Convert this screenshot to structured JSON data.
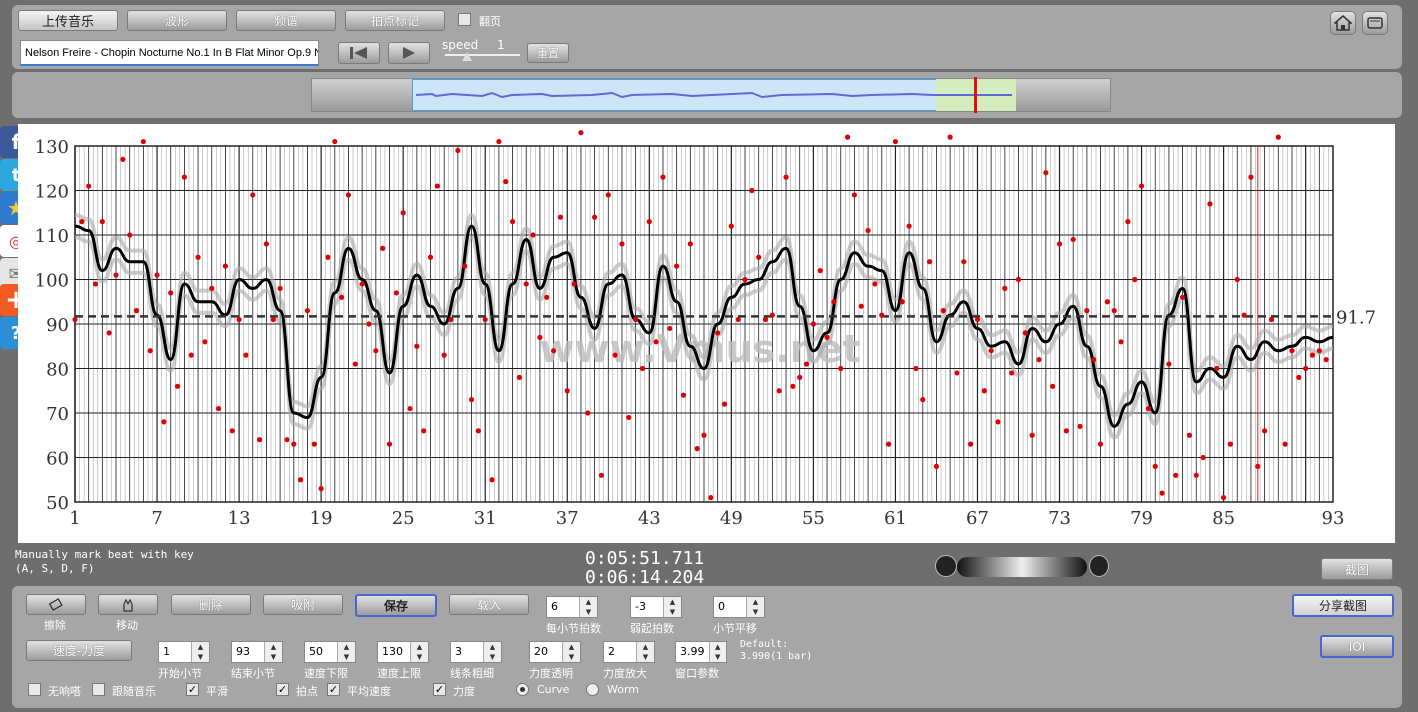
{
  "top": {
    "upload_label": "上传音乐",
    "waveform_label": "波形",
    "spectrum_label": "频谱",
    "beat_label": "拍点标记",
    "flip_label": "翻页",
    "track_title": "Nelson Freire - Chopin Nocturne No.1 In B Flat Minor Op.9 N",
    "speed_label": "speed",
    "speed_value": "1",
    "reset_label": "重置"
  },
  "info": {
    "hint_line1": "Manually mark beat with key",
    "hint_line2": "(A, S, D, F)",
    "time_current": "0:05:51.711",
    "time_total": "0:06:14.204",
    "screenshot_label": "截图",
    "share_label": "分享截图",
    "ioi_label": "IOI"
  },
  "tools": {
    "erase_label": "擦除",
    "move_label": "移动",
    "delete_label": "删除",
    "snap_label": "吸附",
    "save_label": "保存",
    "load_label": "载入",
    "tempo_dynamics_label": "速度-力度",
    "default_line1": "Default:",
    "default_line2": "3.990(1 bar)"
  },
  "params": [
    {
      "value": "6",
      "label": "每小节拍数"
    },
    {
      "value": "-3",
      "label": "弱起拍数"
    },
    {
      "value": "0",
      "label": "小节平移"
    },
    {
      "value": "1",
      "label": "开始小节"
    },
    {
      "value": "93",
      "label": "结束小节"
    },
    {
      "value": "50",
      "label": "速度下限"
    },
    {
      "value": "130",
      "label": "速度上限"
    },
    {
      "value": "3",
      "label": "线条粗细"
    },
    {
      "value": "20",
      "label": "力度透明"
    },
    {
      "value": "2",
      "label": "力度放大"
    },
    {
      "value": "3.99",
      "label": "窗口参数"
    }
  ],
  "options": [
    {
      "label": "无响嗒",
      "checked": false
    },
    {
      "label": "跟随音乐",
      "checked": false
    },
    {
      "label": "平滑",
      "checked": true
    },
    {
      "label": "拍点",
      "checked": true
    },
    {
      "label": "平均速度",
      "checked": true
    },
    {
      "label": "力度",
      "checked": true
    }
  ],
  "modes": [
    {
      "label": "Curve",
      "selected": true
    },
    {
      "label": "Worm",
      "selected": false
    }
  ],
  "side_icons": [
    "facebook-icon",
    "twitter-icon",
    "star-icon",
    "weibo-icon",
    "mail-icon",
    "plus-icon",
    "help-icon"
  ],
  "watermark": "www.Vmus.net",
  "chart_data": {
    "type": "scatter",
    "x_ticks": [
      "1",
      "7",
      "13",
      "19",
      "25",
      "31",
      "37",
      "43",
      "49",
      "55",
      "61",
      "67",
      "73",
      "79",
      "85",
      "93"
    ],
    "y_ticks": [
      "130",
      "120",
      "110",
      "100",
      "90",
      "80",
      "70",
      "60",
      "50"
    ],
    "ylim": [
      50,
      130
    ],
    "xlim": [
      1,
      93
    ],
    "mean_value": 91.7,
    "mean_label": "91.7",
    "smooth_curve": [
      [
        1,
        112
      ],
      [
        2,
        111
      ],
      [
        3,
        102
      ],
      [
        4,
        107
      ],
      [
        5,
        104
      ],
      [
        6,
        104
      ],
      [
        7,
        92
      ],
      [
        8,
        82
      ],
      [
        9,
        99
      ],
      [
        10,
        95
      ],
      [
        11,
        95
      ],
      [
        12,
        92
      ],
      [
        13,
        100
      ],
      [
        14,
        98
      ],
      [
        15,
        100
      ],
      [
        16,
        93
      ],
      [
        17,
        70
      ],
      [
        18,
        69
      ],
      [
        19,
        78
      ],
      [
        20,
        97
      ],
      [
        21,
        107
      ],
      [
        22,
        100
      ],
      [
        23,
        93
      ],
      [
        24,
        79
      ],
      [
        25,
        94
      ],
      [
        26,
        101
      ],
      [
        27,
        94
      ],
      [
        28,
        90
      ],
      [
        29,
        98
      ],
      [
        30,
        112
      ],
      [
        31,
        99
      ],
      [
        32,
        84
      ],
      [
        33,
        99
      ],
      [
        34,
        109
      ],
      [
        35,
        98
      ],
      [
        36,
        105
      ],
      [
        37,
        106
      ],
      [
        38,
        96
      ],
      [
        39,
        89
      ],
      [
        40,
        99
      ],
      [
        41,
        101
      ],
      [
        42,
        91
      ],
      [
        43,
        88
      ],
      [
        44,
        103
      ],
      [
        45,
        95
      ],
      [
        46,
        85
      ],
      [
        47,
        80
      ],
      [
        48,
        90
      ],
      [
        49,
        96
      ],
      [
        50,
        99
      ],
      [
        51,
        100
      ],
      [
        52,
        104
      ],
      [
        53,
        107
      ],
      [
        54,
        94
      ],
      [
        55,
        84
      ],
      [
        56,
        88
      ],
      [
        57,
        100
      ],
      [
        58,
        106
      ],
      [
        59,
        103
      ],
      [
        60,
        102
      ],
      [
        61,
        93
      ],
      [
        62,
        106
      ],
      [
        63,
        98
      ],
      [
        64,
        86
      ],
      [
        65,
        92
      ],
      [
        66,
        95
      ],
      [
        67,
        89
      ],
      [
        68,
        85
      ],
      [
        69,
        86
      ],
      [
        70,
        81
      ],
      [
        71,
        89
      ],
      [
        72,
        86
      ],
      [
        73,
        90
      ],
      [
        74,
        94
      ],
      [
        75,
        85
      ],
      [
        76,
        76
      ],
      [
        77,
        67
      ],
      [
        78,
        72
      ],
      [
        79,
        77
      ],
      [
        80,
        70
      ],
      [
        81,
        92
      ],
      [
        82,
        98
      ],
      [
        83,
        77
      ],
      [
        84,
        80
      ],
      [
        85,
        78
      ],
      [
        86,
        85
      ],
      [
        87,
        82
      ],
      [
        88,
        86
      ],
      [
        89,
        84
      ],
      [
        90,
        85
      ],
      [
        91,
        87
      ],
      [
        92,
        86
      ],
      [
        93,
        87
      ]
    ],
    "beats": [
      [
        1,
        91
      ],
      [
        1.5,
        113
      ],
      [
        2,
        121
      ],
      [
        2.5,
        99
      ],
      [
        3,
        113
      ],
      [
        3.5,
        88
      ],
      [
        4,
        101
      ],
      [
        4.5,
        127
      ],
      [
        5,
        110
      ],
      [
        5.5,
        93
      ],
      [
        6,
        131
      ],
      [
        6.5,
        84
      ],
      [
        7,
        101
      ],
      [
        7.5,
        68
      ],
      [
        8,
        97
      ],
      [
        8.5,
        76
      ],
      [
        9,
        123
      ],
      [
        9.5,
        83
      ],
      [
        10,
        105
      ],
      [
        10.5,
        86
      ],
      [
        11,
        98
      ],
      [
        11.5,
        71
      ],
      [
        12,
        103
      ],
      [
        12.5,
        66
      ],
      [
        13,
        91
      ],
      [
        13.5,
        83
      ],
      [
        14,
        119
      ],
      [
        14.5,
        64
      ],
      [
        15,
        108
      ],
      [
        15.5,
        91
      ],
      [
        16,
        98
      ],
      [
        16.5,
        64
      ],
      [
        17,
        63
      ],
      [
        17.5,
        55
      ],
      [
        18,
        93
      ],
      [
        18.5,
        63
      ],
      [
        19,
        53
      ],
      [
        19.5,
        105
      ],
      [
        20,
        131
      ],
      [
        20.5,
        96
      ],
      [
        21,
        119
      ],
      [
        21.5,
        81
      ],
      [
        22,
        99
      ],
      [
        22.5,
        90
      ],
      [
        23,
        84
      ],
      [
        23.5,
        107
      ],
      [
        24,
        63
      ],
      [
        24.5,
        97
      ],
      [
        25,
        115
      ],
      [
        25.5,
        71
      ],
      [
        26,
        85
      ],
      [
        26.5,
        66
      ],
      [
        27,
        105
      ],
      [
        27.5,
        121
      ],
      [
        28,
        83
      ],
      [
        28.5,
        91
      ],
      [
        29,
        129
      ],
      [
        29.5,
        103
      ],
      [
        30,
        73
      ],
      [
        30.5,
        66
      ],
      [
        31,
        91
      ],
      [
        31.5,
        55
      ],
      [
        32,
        131
      ],
      [
        32.5,
        122
      ],
      [
        33,
        113
      ],
      [
        33.5,
        78
      ],
      [
        34,
        99
      ],
      [
        34.5,
        110
      ],
      [
        35,
        87
      ],
      [
        35.5,
        96
      ],
      [
        36,
        84
      ],
      [
        36.5,
        114
      ],
      [
        37,
        75
      ],
      [
        37.5,
        99
      ],
      [
        38,
        133
      ],
      [
        38.5,
        70
      ],
      [
        39,
        114
      ],
      [
        39.5,
        56
      ],
      [
        40,
        119
      ],
      [
        40.5,
        83
      ],
      [
        41,
        108
      ],
      [
        41.5,
        69
      ],
      [
        42,
        91
      ],
      [
        42.5,
        80
      ],
      [
        43,
        113
      ],
      [
        43.5,
        86
      ],
      [
        44,
        123
      ],
      [
        44.5,
        89
      ],
      [
        45,
        103
      ],
      [
        45.5,
        74
      ],
      [
        46,
        108
      ],
      [
        46.5,
        62
      ],
      [
        47,
        65
      ],
      [
        47.5,
        51
      ],
      [
        48,
        88
      ],
      [
        48.5,
        72
      ],
      [
        49,
        112
      ],
      [
        49.5,
        91
      ],
      [
        50,
        100
      ],
      [
        50.5,
        120
      ],
      [
        51,
        105
      ],
      [
        51.5,
        91
      ],
      [
        52,
        92
      ],
      [
        52.5,
        75
      ],
      [
        53,
        123
      ],
      [
        53.5,
        76
      ],
      [
        54,
        78
      ],
      [
        54.5,
        81
      ],
      [
        55,
        90
      ],
      [
        55.5,
        102
      ],
      [
        56,
        87
      ],
      [
        56.5,
        95
      ],
      [
        57,
        80
      ],
      [
        57.5,
        132
      ],
      [
        58,
        119
      ],
      [
        58.5,
        94
      ],
      [
        59,
        111
      ],
      [
        59.5,
        99
      ],
      [
        60,
        92
      ],
      [
        60.5,
        63
      ],
      [
        61,
        131
      ],
      [
        61.5,
        95
      ],
      [
        62,
        112
      ],
      [
        62.5,
        80
      ],
      [
        63,
        73
      ],
      [
        63.5,
        104
      ],
      [
        64,
        58
      ],
      [
        64.5,
        93
      ],
      [
        65,
        132
      ],
      [
        65.5,
        79
      ],
      [
        66,
        104
      ],
      [
        66.5,
        63
      ],
      [
        67,
        91
      ],
      [
        67.5,
        75
      ],
      [
        68,
        84
      ],
      [
        68.5,
        68
      ],
      [
        69,
        98
      ],
      [
        69.5,
        79
      ],
      [
        70,
        100
      ],
      [
        70.5,
        88
      ],
      [
        71,
        65
      ],
      [
        71.5,
        82
      ],
      [
        72,
        124
      ],
      [
        72.5,
        76
      ],
      [
        73,
        108
      ],
      [
        73.5,
        66
      ],
      [
        74,
        109
      ],
      [
        74.5,
        67
      ],
      [
        75,
        93
      ],
      [
        75.5,
        82
      ],
      [
        76,
        63
      ],
      [
        76.5,
        95
      ],
      [
        77,
        93
      ],
      [
        77.5,
        86
      ],
      [
        78,
        113
      ],
      [
        78.5,
        100
      ],
      [
        79,
        121
      ],
      [
        79.5,
        71
      ],
      [
        80,
        58
      ],
      [
        80.5,
        52
      ],
      [
        81,
        81
      ],
      [
        81.5,
        56
      ],
      [
        82,
        96
      ],
      [
        82.5,
        65
      ],
      [
        83,
        56
      ],
      [
        83.5,
        60
      ],
      [
        84,
        117
      ],
      [
        84.5,
        80
      ],
      [
        85,
        51
      ],
      [
        85.5,
        63
      ],
      [
        86,
        100
      ],
      [
        86.5,
        92
      ],
      [
        87,
        123
      ],
      [
        87.5,
        58
      ],
      [
        88,
        66
      ],
      [
        88.5,
        91
      ],
      [
        89,
        132
      ],
      [
        89.5,
        63
      ],
      [
        90,
        84
      ],
      [
        90.5,
        78
      ],
      [
        91,
        80
      ],
      [
        91.5,
        83
      ],
      [
        92,
        84
      ],
      [
        92.5,
        82
      ]
    ]
  }
}
